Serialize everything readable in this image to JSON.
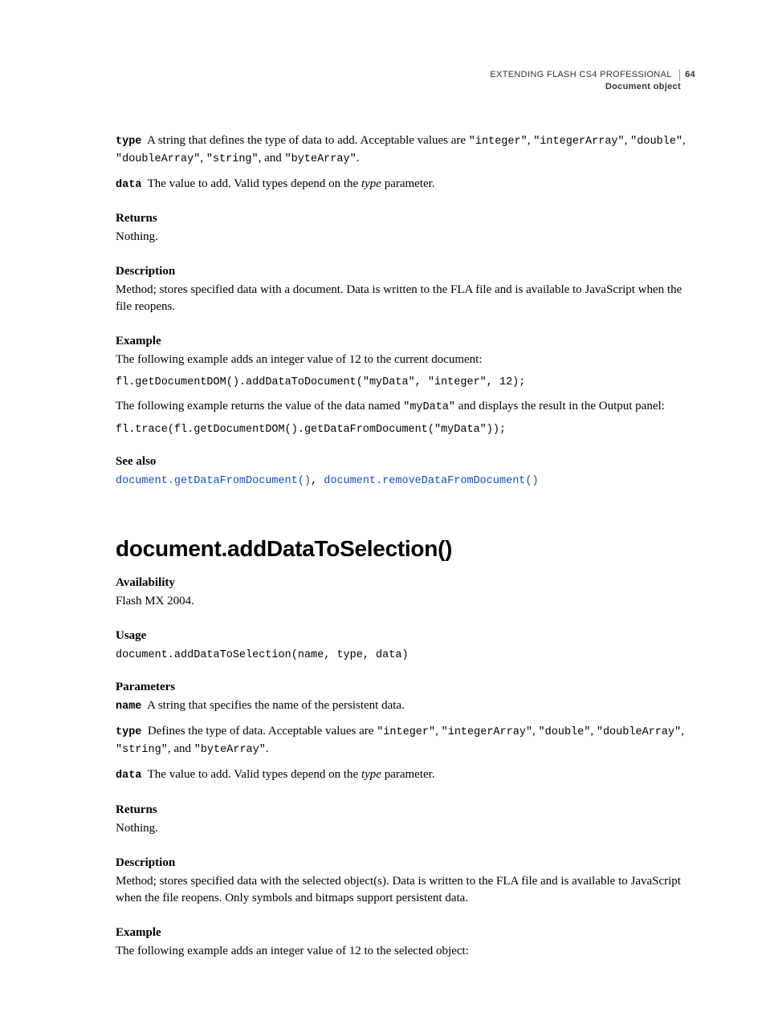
{
  "header": {
    "title": "EXTENDING FLASH CS4 PROFESSIONAL",
    "pagenum": "64",
    "section": "Document object"
  },
  "sec1": {
    "type_param": "type",
    "type_text_a": "A string that defines the type of data to add. Acceptable values are ",
    "vals": [
      "\"integer\"",
      "\"integerArray\"",
      "\"double\"",
      "\"doubleArray\"",
      "\"string\"",
      "\"byteArray\""
    ],
    "and": ", and ",
    "period": ".",
    "data_param": "data",
    "data_text_a": "The value to add. Valid types depend on the ",
    "data_text_b": "type",
    "data_text_c": " parameter.",
    "returns_h": "Returns",
    "returns_t": "Nothing.",
    "desc_h": "Description",
    "desc_t": "Method; stores specified data with a document. Data is written to the FLA file and is available to JavaScript when the file reopens.",
    "ex_h": "Example",
    "ex_t1": "The following example adds an integer value of 12 to the current document:",
    "ex_code1": "fl.getDocumentDOM().addDataToDocument(\"myData\", \"integer\", 12);",
    "ex_t2a": "The following example returns the value of the data named ",
    "ex_t2b": "\"myData\"",
    "ex_t2c": " and displays the result in the Output panel:",
    "ex_code2": "fl.trace(fl.getDocumentDOM().getDataFromDocument(\"myData\"));",
    "see_h": "See also",
    "see1": "document.getDataFromDocument()",
    "see2": "document.removeDataFromDocument()"
  },
  "sec2": {
    "title": "document.addDataToSelection()",
    "avail_h": "Availability",
    "avail_t": "Flash MX 2004.",
    "usage_h": "Usage",
    "usage_code": "document.addDataToSelection(name, type, data)",
    "params_h": "Parameters",
    "name_param": "name",
    "name_text": "A string that specifies the name of the persistent data.",
    "type_param": "type",
    "type_text_a": "Defines the type of data. Acceptable values are ",
    "vals": [
      "\"integer\"",
      "\"integerArray\"",
      "\"double\"",
      "\"doubleArray\"",
      "\"string\"",
      "\"byteArray\""
    ],
    "and": ", and ",
    "period": ".",
    "data_param": "data",
    "data_text_a": "The value to add. Valid types depend on the ",
    "data_text_b": "type",
    "data_text_c": " parameter.",
    "returns_h": "Returns",
    "returns_t": "Nothing.",
    "desc_h": "Description",
    "desc_t": "Method; stores specified data with the selected object(s). Data is written to the FLA file and is available to JavaScript when the file reopens. Only symbols and bitmaps support persistent data.",
    "ex_h": "Example",
    "ex_t1": "The following example adds an integer value of 12 to the selected object:"
  }
}
